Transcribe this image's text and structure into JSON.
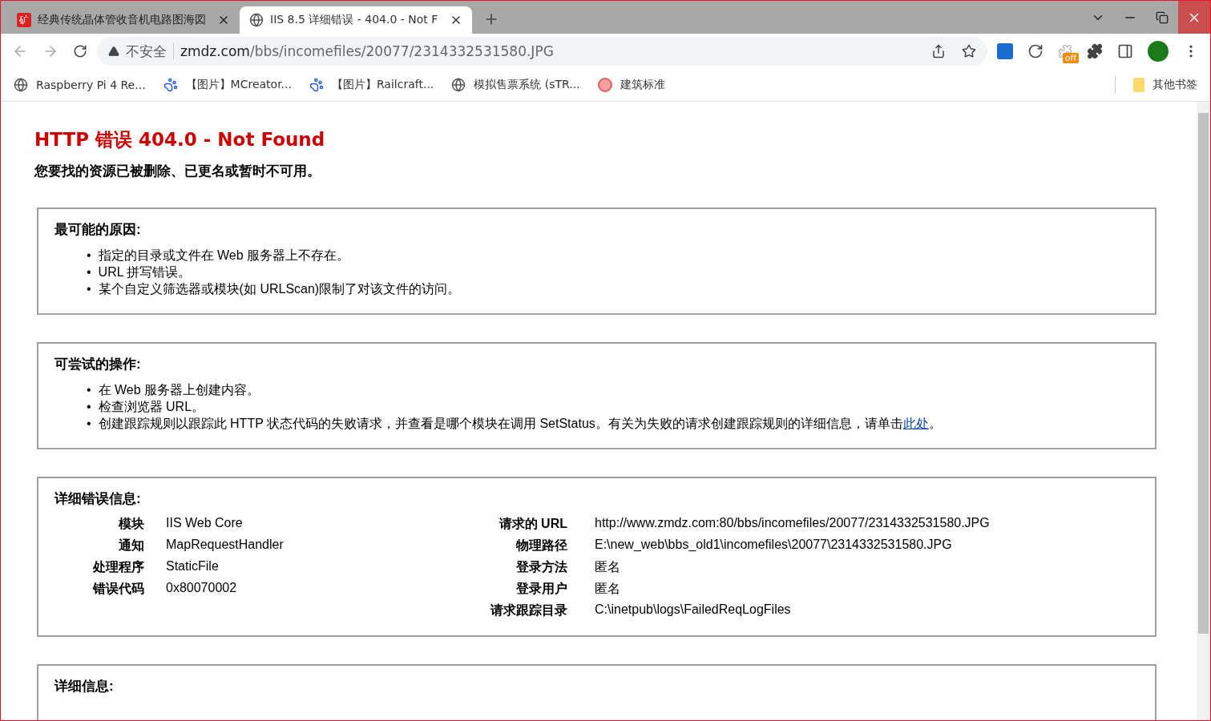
{
  "tabs": [
    {
      "title": "经典传统晶体管收音机电路图海図",
      "favicon": "矿",
      "selected": false
    },
    {
      "title": "IIS 8.5 详细错误 - 404.0 - Not F",
      "selected": true
    }
  ],
  "address_bar": {
    "security": "不安全",
    "url_host": "zmdz.com",
    "url_path": "/bbs/incomefiles/20077/2314332531580.JPG"
  },
  "extension_badge": "off",
  "bookmarks": [
    {
      "label": "Raspberry Pi 4 Re...",
      "kind": "globe"
    },
    {
      "label": "【图片】MCreator...",
      "kind": "paw"
    },
    {
      "label": "【图片】Railcraft...",
      "kind": "paw"
    },
    {
      "label": "模拟售票系统 (sTR...",
      "kind": "globe"
    },
    {
      "label": "建筑标准",
      "kind": "seal"
    }
  ],
  "other_bookmarks": "其他书签",
  "page": {
    "title": "HTTP 错误 404.0 - Not Found",
    "subtitle": "您要找的资源已被删除、已更名或暂时不可用。",
    "sections": [
      {
        "heading": "最可能的原因:",
        "bullet": "•",
        "items": [
          "指定的目录或文件在 Web 服务器上不存在。",
          "URL 拼写错误。",
          "某个自定义筛选器或模块(如 URLScan)限制了对该文件的访问。"
        ]
      },
      {
        "heading": "可尝试的操作:",
        "bullet": "•",
        "items": [
          "在 Web 服务器上创建内容。",
          "检查浏览器 URL。",
          "创建跟踪规则以跟踪此 HTTP 状态代码的失败请求，并查看是哪个模块在调用 SetStatus。有关为失败的请求创建跟踪规则的详细信息，请单击"
        ],
        "link": "此处",
        "link_after": "。"
      },
      {
        "heading": "详细错误信息:",
        "details_left": [
          {
            "label": "模块",
            "value": "IIS Web Core"
          },
          {
            "label": "通知",
            "value": "MapRequestHandler"
          },
          {
            "label": "处理程序",
            "value": "StaticFile"
          },
          {
            "label": "错误代码",
            "value": "0x80070002"
          }
        ],
        "details_right": [
          {
            "label": "请求的 URL",
            "value": "http://www.zmdz.com:80/bbs/incomefiles/20077/2314332531580.JPG"
          },
          {
            "label": "物理路径",
            "value": "E:\\new_web\\bbs_old1\\incomefiles\\20077\\2314332531580.JPG"
          },
          {
            "label": "登录方法",
            "value": "匿名"
          },
          {
            "label": "登录用户",
            "value": "匿名"
          },
          {
            "label": "请求跟踪目录",
            "value": "C:\\inetpub\\logs\\FailedReqLogFiles"
          }
        ]
      },
      {
        "heading": "详细信息:"
      }
    ]
  }
}
